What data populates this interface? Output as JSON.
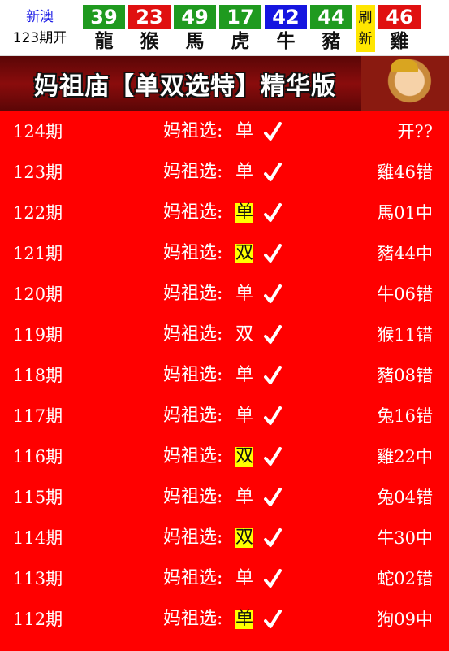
{
  "header": {
    "region": "新澳",
    "issue": "123期开",
    "balls": [
      {
        "number": "39",
        "zodiac": "龍",
        "color": "green"
      },
      {
        "number": "23",
        "zodiac": "猴",
        "color": "red"
      },
      {
        "number": "49",
        "zodiac": "馬",
        "color": "green"
      },
      {
        "number": "17",
        "zodiac": "虎",
        "color": "green"
      },
      {
        "number": "42",
        "zodiac": "牛",
        "color": "blue"
      },
      {
        "number": "44",
        "zodiac": "豬",
        "color": "green"
      },
      {
        "number": "46",
        "zodiac": "雞",
        "color": "red"
      }
    ],
    "refresh": [
      "刷",
      "新"
    ]
  },
  "banner": {
    "title": "妈祖庙【单双选特】精华版"
  },
  "rows": [
    {
      "period": "124期",
      "label": "妈祖选:",
      "pick": "单",
      "hit": false,
      "result": "开??"
    },
    {
      "period": "123期",
      "label": "妈祖选:",
      "pick": "单",
      "hit": false,
      "result": "雞46错"
    },
    {
      "period": "122期",
      "label": "妈祖选:",
      "pick": "单",
      "hit": true,
      "result": "馬01中"
    },
    {
      "period": "121期",
      "label": "妈祖选:",
      "pick": "双",
      "hit": true,
      "result": "豬44中"
    },
    {
      "period": "120期",
      "label": "妈祖选:",
      "pick": "单",
      "hit": false,
      "result": "牛06错"
    },
    {
      "period": "119期",
      "label": "妈祖选:",
      "pick": "双",
      "hit": false,
      "result": "猴11错"
    },
    {
      "period": "118期",
      "label": "妈祖选:",
      "pick": "单",
      "hit": false,
      "result": "豬08错"
    },
    {
      "period": "117期",
      "label": "妈祖选:",
      "pick": "单",
      "hit": false,
      "result": "兔16错"
    },
    {
      "period": "116期",
      "label": "妈祖选:",
      "pick": "双",
      "hit": true,
      "result": "雞22中"
    },
    {
      "period": "115期",
      "label": "妈祖选:",
      "pick": "单",
      "hit": false,
      "result": "兔04错"
    },
    {
      "period": "114期",
      "label": "妈祖选:",
      "pick": "双",
      "hit": true,
      "result": "牛30中"
    },
    {
      "period": "113期",
      "label": "妈祖选:",
      "pick": "单",
      "hit": false,
      "result": "蛇02错"
    },
    {
      "period": "112期",
      "label": "妈祖选:",
      "pick": "单",
      "hit": true,
      "result": "狗09中"
    }
  ],
  "colors": {
    "green": "#1f9a1f",
    "red": "#e01010",
    "blue": "#1515e0",
    "list_bg": "#ff0000",
    "highlight": "#ffff00"
  },
  "icons": {
    "check": "check-icon",
    "refresh": "refresh-button"
  }
}
